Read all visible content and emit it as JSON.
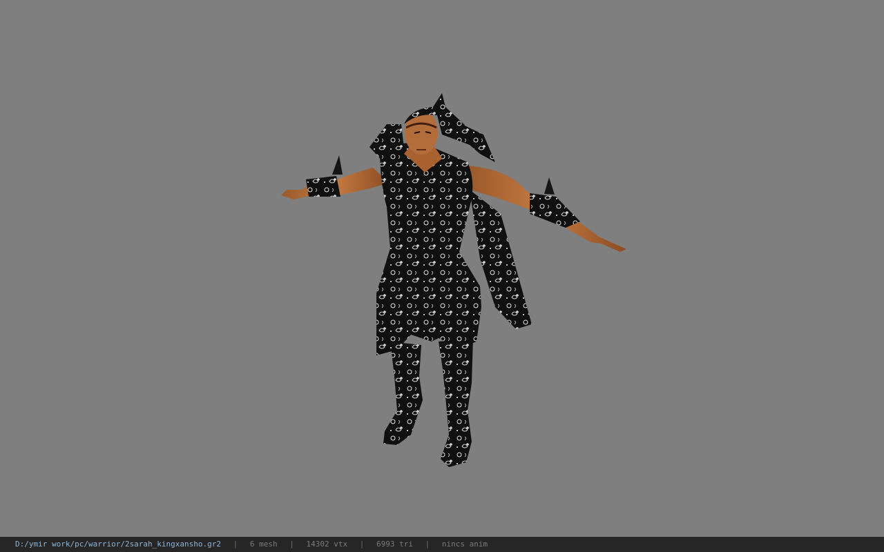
{
  "viewer": {
    "background_color": "#7f7f7f",
    "model_icon": "character-model"
  },
  "status": {
    "file_path": "D:/ymir work/pc/warrior/2sarah_kingxansho.gr2",
    "separator": "|",
    "mesh_count": "6 mesh",
    "vertex_count": "14302 vtx",
    "triangle_count": "6993 tri",
    "animation": "nincs anim"
  }
}
